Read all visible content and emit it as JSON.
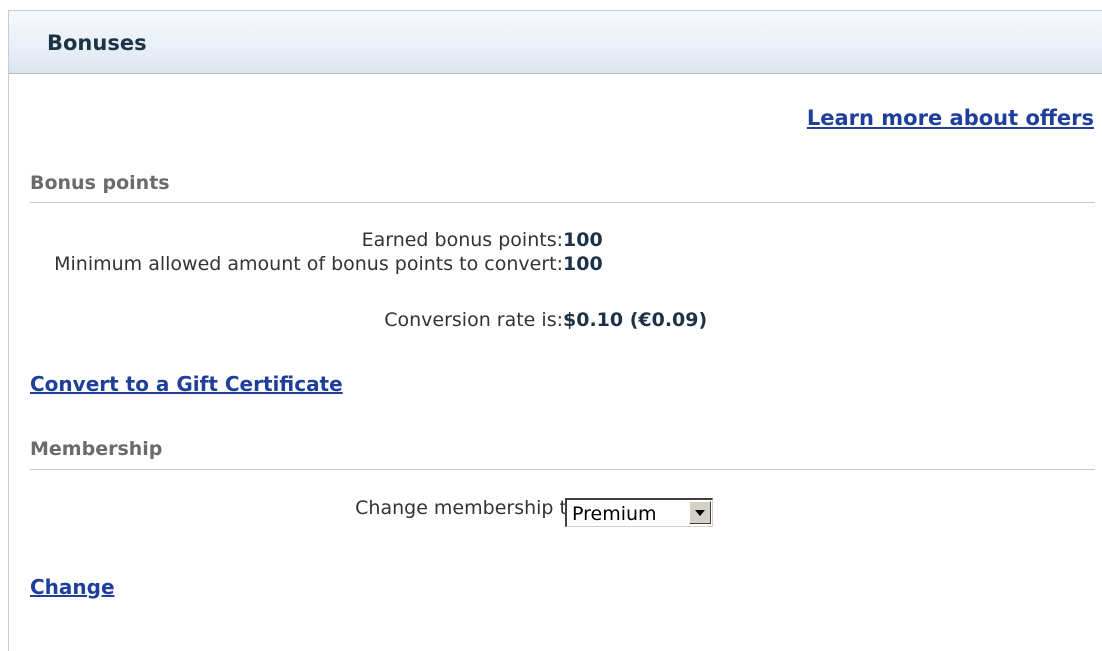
{
  "panel": {
    "title": "Bonuses"
  },
  "links": {
    "learn_more": "Learn more about offers",
    "convert": "Convert to a Gift Certificate",
    "change": "Change"
  },
  "bonus_points": {
    "heading": "Bonus points",
    "rows": [
      {
        "label": "Earned bonus points:",
        "value": "100"
      },
      {
        "label": "Minimum allowed amount of bonus points to convert:",
        "value": "100"
      },
      {
        "label": "Conversion rate is:",
        "value": "$0.10 (€0.09)"
      }
    ]
  },
  "membership": {
    "heading": "Membership",
    "change_label": "Change membership to:",
    "selected_option": "Premium"
  },
  "icons": {
    "dropdown": "chevron-down-icon"
  },
  "colors": {
    "link": "#1f3f9a",
    "heading": "#6b6b6b",
    "value": "#1c3347"
  }
}
